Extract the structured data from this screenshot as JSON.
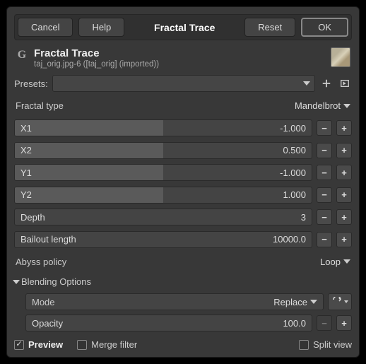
{
  "toolbar": {
    "cancel": "Cancel",
    "help": "Help",
    "title": "Fractal Trace",
    "reset": "Reset",
    "ok": "OK"
  },
  "header": {
    "logo": "G",
    "title": "Fractal Trace",
    "subtitle": "taj_orig.jpg-6 ([taj_orig] (imported))"
  },
  "presets_label": "Presets:",
  "fractal_type": {
    "label": "Fractal type",
    "value": "Mandelbrot"
  },
  "params": {
    "x1": {
      "label": "X1",
      "value": "-1.000",
      "fill": 50
    },
    "x2": {
      "label": "X2",
      "value": "0.500",
      "fill": 50
    },
    "y1": {
      "label": "Y1",
      "value": "-1.000",
      "fill": 50
    },
    "y2": {
      "label": "Y2",
      "value": "1.000",
      "fill": 50
    },
    "depth": {
      "label": "Depth",
      "value": "3",
      "fill": 0
    },
    "bailout": {
      "label": "Bailout length",
      "value": "10000.0",
      "fill": 0
    }
  },
  "abyss": {
    "label": "Abyss policy",
    "value": "Loop"
  },
  "blending": {
    "header": "Blending Options",
    "mode_label": "Mode",
    "mode_value": "Replace",
    "opacity_label": "Opacity",
    "opacity_value": "100.0"
  },
  "bottom": {
    "preview": "Preview",
    "merge": "Merge filter",
    "split": "Split view"
  }
}
